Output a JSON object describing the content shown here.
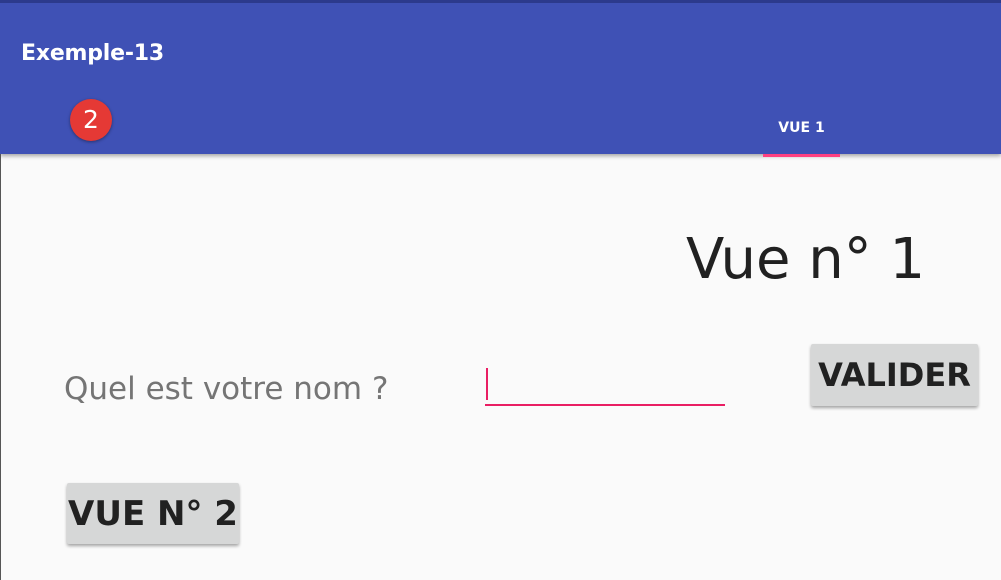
{
  "app_bar": {
    "title": "Exemple-13",
    "badge_count": "2",
    "background_color": "#3f51b5"
  },
  "tabs": [
    {
      "label": "VUE 1",
      "selected": true,
      "indicator_color": "#ff4081"
    }
  ],
  "content": {
    "view_title": "Vue n° 1",
    "question_label": "Quel est votre nom ?",
    "name_input": {
      "value": "",
      "placeholder": ""
    },
    "validate_button_label": "VALIDER",
    "goto_view2_button_label": "VUE N° 2"
  }
}
